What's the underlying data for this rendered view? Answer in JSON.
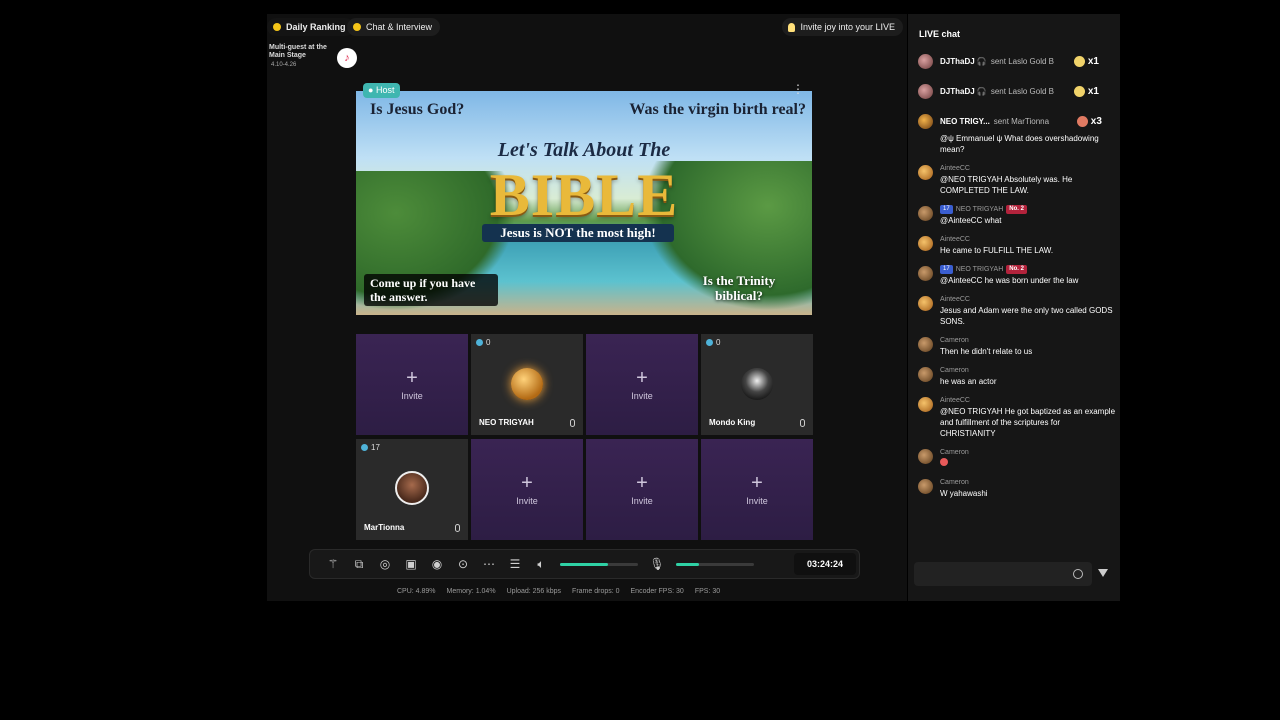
{
  "top_bar": {
    "daily_ranking": "Daily Ranking",
    "chat_interview": "Chat & Interview",
    "invite_joy": "Invite joy into your LIVE"
  },
  "event": {
    "title": "Multi-guest at the Main Stage",
    "dates": "4.10-4.26"
  },
  "host_tag": "Host",
  "banner": {
    "q1": "Is Jesus God?",
    "q2": "Was the virgin birth real?",
    "lets": "Let's Talk About The",
    "bible": "BIBLE",
    "not_most": "Jesus is NOT the most high!",
    "come_up": "Come up if you have the answer.",
    "trinity": "Is the Trinity biblical?"
  },
  "tiles": [
    {
      "type": "invite",
      "label": "Invite"
    },
    {
      "type": "guest",
      "name": "NEO TRIGYAH",
      "count": "0"
    },
    {
      "type": "invite",
      "label": "Invite"
    },
    {
      "type": "guest",
      "name": "Mondo King",
      "count": "0"
    },
    {
      "type": "guest",
      "name": "MarTionna",
      "count": "17"
    },
    {
      "type": "invite",
      "label": "Invite"
    },
    {
      "type": "invite",
      "label": "Invite"
    },
    {
      "type": "invite",
      "label": "Invite"
    }
  ],
  "toolbar": {
    "time": "03:24:24",
    "volume_level": 0.62,
    "mic_level": 0.3
  },
  "stats": {
    "cpu": "CPU: 4.89%",
    "memory": "Memory: 1.04%",
    "upload": "Upload: 256 kbps",
    "frame_drops": "Frame drops: 0",
    "encoder_fps": "Encoder FPS: 30",
    "fps": "FPS: 30"
  },
  "chat": {
    "title": "LIVE chat",
    "gifts": [
      {
        "user": "DJThaDJ 🎧",
        "text": "sent Laslo Gold B",
        "mult": "x1"
      },
      {
        "user": "DJThaDJ 🎧",
        "text": "sent Laslo Gold B",
        "mult": "x1"
      },
      {
        "user": "NEO TRIGY...",
        "text": "sent MarTionna",
        "mult": "x3"
      }
    ],
    "messages": [
      {
        "name": "",
        "text": "@ψ Emmanuel ψ What does overshadowing mean?"
      },
      {
        "name": "AinteeCC",
        "text": "@NEO TRIGYAH Absolutely was. He COMPLETED THE LAW."
      },
      {
        "name": "NEO TRIGYAH",
        "level": "17",
        "rank": "No. 2",
        "text": "@AinteeCC what"
      },
      {
        "name": "AinteeCC",
        "text": "He came to FULFILL THE LAW."
      },
      {
        "name": "NEO TRIGYAH",
        "level": "17",
        "rank": "No. 2",
        "text": "@AinteeCC he was born under the law"
      },
      {
        "name": "AinteeCC",
        "text": "Jesus and Adam were the only two called GODS SONS."
      },
      {
        "name": "Cameron",
        "text": "Then he didn't relate to us"
      },
      {
        "name": "Cameron",
        "text": "he was an actor"
      },
      {
        "name": "AinteeCC",
        "text": "@NEO TRIGYAH He got baptized as an example and fulfillment of the scriptures for CHRISTIANITY"
      },
      {
        "name": "Cameron",
        "text": ""
      },
      {
        "name": "Cameron",
        "text": "W yahawashi"
      }
    ],
    "input_placeholder": ""
  }
}
